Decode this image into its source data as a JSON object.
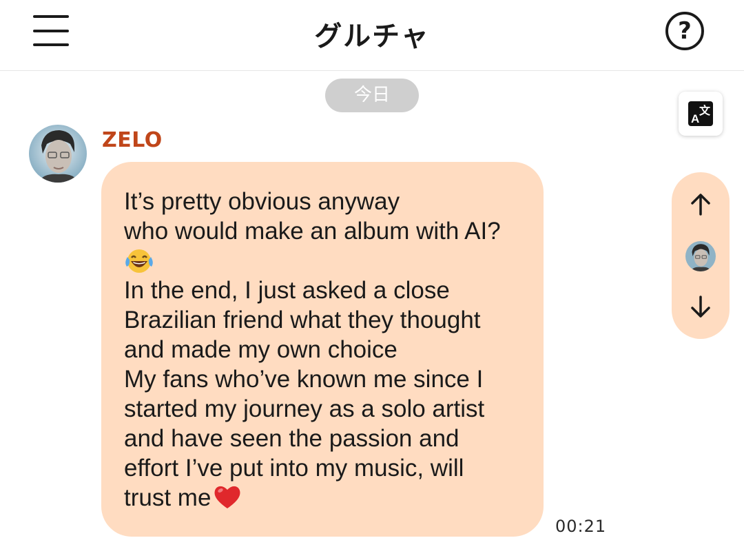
{
  "header": {
    "title": "グルチャ",
    "menu_icon": "hamburger-menu-icon",
    "help_icon": "help-question-icon",
    "help_glyph": "?"
  },
  "chat": {
    "date_label": "今日",
    "translate_icon": "translate-icon",
    "message": {
      "sender": "ZELO",
      "sender_color": "#c0461a",
      "bubble_color": "#ffdcc1",
      "lines": [
        "It’s pretty obvious anyway",
        "who would make an album with AI?",
        "",
        "In the end, I just asked a close",
        "Brazilian friend what they thought",
        "and made my own choice",
        "My fans who’ve known me since I",
        "started my journey as a solo artist",
        "and have seen the passion and",
        "effort I’ve put into my music, will",
        "trust me"
      ],
      "emojis": [
        "laughing-tears-emoji",
        "red-heart-emoji"
      ],
      "time": "00:21"
    }
  },
  "side_nav": {
    "up_icon": "arrow-up-icon",
    "down_icon": "arrow-down-icon"
  }
}
